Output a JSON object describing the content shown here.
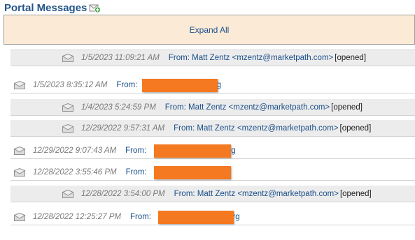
{
  "header": {
    "title": "Portal Messages",
    "add_icon": "add-message-icon"
  },
  "toolbar": {
    "expand_all_label": "Expand All"
  },
  "colors": {
    "redaction": "#f47920",
    "expand_bar": "#fbebd6",
    "child_row": "#ececec",
    "link": "#1a4f8a"
  },
  "messages": [
    {
      "date": "1/5/2023 11:09:21 AM",
      "from": "From: Matt Zentz <mzentz@marketpath.com>",
      "status": "[opened]",
      "reply": true
    },
    {
      "date": "1/5/2023 8:35:12 AM",
      "from_prefix": "From:",
      "from_suffix": "org",
      "reply": false,
      "redacted": true
    },
    {
      "date": "1/4/2023 5:24:59 PM",
      "from": "From: Matt Zentz <mzentz@marketpath.com>",
      "status": "[opened]",
      "reply": true
    },
    {
      "date": "12/29/2022 9:57:31 AM",
      "from": "From: Matt Zentz <mzentz@marketpath.com>",
      "status": "[opened]",
      "reply": true
    },
    {
      "date": "12/29/2022 9:07:43 AM",
      "from_prefix": "From:",
      "from_suffix": "org",
      "reply": false,
      "redacted": true
    },
    {
      "date": "12/28/2022 3:55:46 PM",
      "from_prefix": "From:",
      "from_suffix": "",
      "reply": false,
      "redacted": true
    },
    {
      "date": "12/28/2022 3:54:00 PM",
      "from": "From: Matt Zentz <mzentz@marketpath.com>",
      "status": "[opened]",
      "reply": true
    },
    {
      "date": "12/28/2022 12:25:27 PM",
      "from_prefix": "From:",
      "from_suffix": "org",
      "reply": false,
      "redacted": true
    }
  ]
}
